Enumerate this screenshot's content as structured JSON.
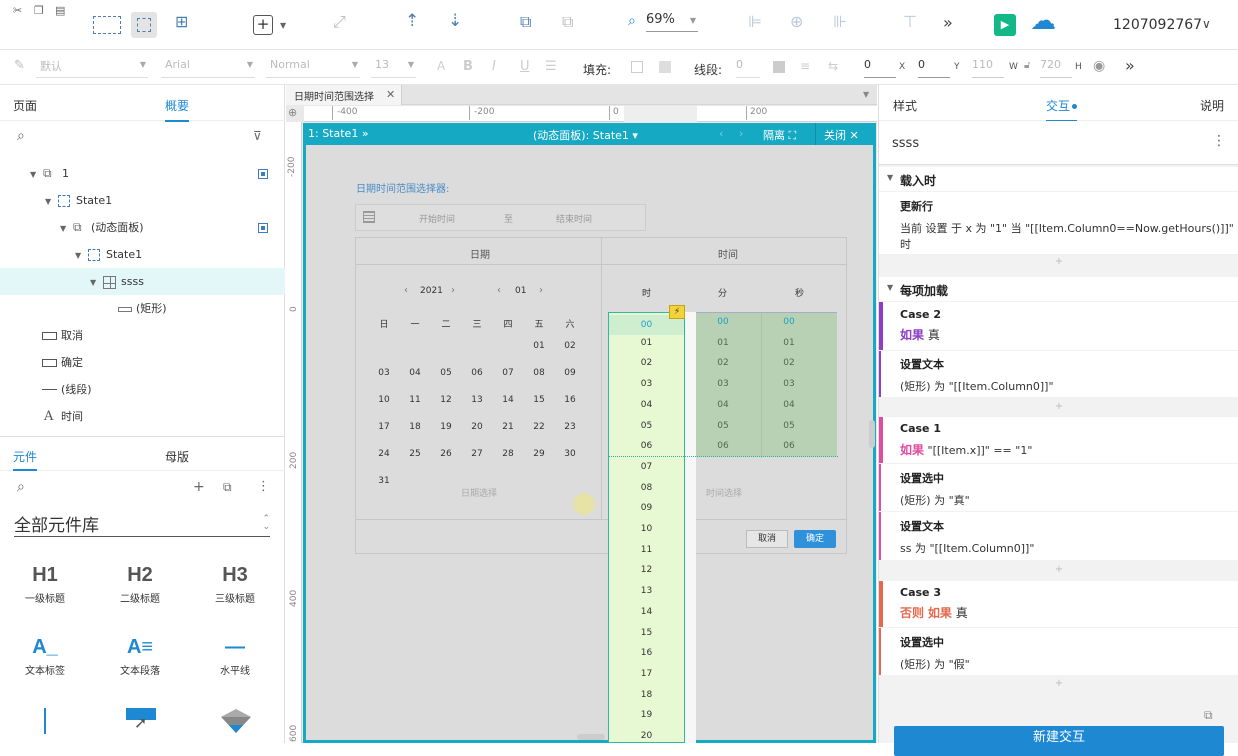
{
  "toolbar": {
    "zoom": "69%",
    "user": "1207092767"
  },
  "format": {
    "style_default": "默认",
    "font": "Arial",
    "weight": "Normal",
    "size": "13",
    "fill_label": "填充:",
    "line_label": "线段:",
    "line_value": "0",
    "x": "0",
    "x_label": "X",
    "y": "0",
    "y_label": "Y",
    "w": "110",
    "w_label": "W",
    "h": "720",
    "h_label": "H"
  },
  "left": {
    "tab_pages": "页面",
    "tab_outline": "概要",
    "tree": [
      {
        "label": "1"
      },
      {
        "label": "State1"
      },
      {
        "label": "(动态面板)"
      },
      {
        "label": "State1"
      },
      {
        "label": "ssss"
      },
      {
        "label": "(矩形)"
      },
      {
        "label": "取消"
      },
      {
        "label": "确定"
      },
      {
        "label": "(线段)"
      },
      {
        "label": "时间"
      }
    ],
    "tab_widgets": "元件",
    "tab_masters": "母版",
    "library": "全部元件库",
    "widgets": [
      {
        "icon": "H1",
        "label": "一级标题"
      },
      {
        "icon": "H2",
        "label": "二级标题"
      },
      {
        "icon": "H3",
        "label": "三级标题"
      },
      {
        "icon": "A_",
        "label": "文本标签"
      },
      {
        "icon": "A≡",
        "label": "文本段落"
      },
      {
        "icon": "—",
        "label": "水平线"
      }
    ]
  },
  "canvas": {
    "doc_tab": "日期时间范围选择",
    "ruler_h": [
      "-400",
      "-200",
      "0",
      "200"
    ],
    "ruler_v": [
      "-200",
      "0",
      "200",
      "400",
      "600"
    ],
    "editor_state": "1: State1",
    "editor_panel": "(动态面板): State1",
    "isolate": "隔离",
    "close": "关闭",
    "widget": {
      "title": "日期时间范围选择器:",
      "start": "开始时间",
      "to": "至",
      "end": "结束时间",
      "date_header": "日期",
      "time_header": "时间",
      "year": "2021",
      "month": "01",
      "weekdays": [
        "日",
        "一",
        "二",
        "三",
        "四",
        "五",
        "六"
      ],
      "days": [
        "01",
        "02",
        "03",
        "04",
        "05",
        "06",
        "07",
        "08",
        "09",
        "10",
        "11",
        "12",
        "13",
        "14",
        "15",
        "16",
        "17",
        "18",
        "19",
        "20",
        "21",
        "22",
        "23",
        "24",
        "25",
        "26",
        "27",
        "28",
        "29",
        "30",
        "31"
      ],
      "date_hint": "日期选择",
      "time_hint": "时间选择",
      "col_hour": "时",
      "col_min": "分",
      "col_sec": "秒",
      "hours": [
        "00",
        "01",
        "02",
        "03",
        "04",
        "05",
        "06",
        "07",
        "08",
        "09",
        "10",
        "11",
        "12",
        "13",
        "14",
        "15",
        "16",
        "17",
        "18",
        "19",
        "20"
      ],
      "mins": [
        "00",
        "01",
        "02",
        "03",
        "04",
        "05",
        "06"
      ],
      "cancel": "取消",
      "ok": "确定"
    }
  },
  "right": {
    "tab_style": "样式",
    "tab_interact": "交互",
    "tab_notes": "说明",
    "element_name": "ssss",
    "section1": "载入时",
    "s1_action": "更新行",
    "s1_desc1": "当前 设置 于 x 为 \"1\" 当 \"[[Item.Column0==Now.getHours()]]\"",
    "s1_desc2": "时",
    "section2": "每项加载",
    "case2": "Case 2",
    "case2_if": "如果",
    "case2_cond": "真",
    "case2_action": "设置文本",
    "case2_desc": "(矩形) 为 \"[[Item.Column0]]\"",
    "case1": "Case 1",
    "case1_if": "如果",
    "case1_cond": "\"[[Item.x]]\" == \"1\"",
    "case1_action1": "设置选中",
    "case1_desc1": "(矩形) 为 \"真\"",
    "case1_action2": "设置文本",
    "case1_desc2": "ss 为 \"[[Item.Column0]]\"",
    "case3": "Case 3",
    "case3_else": "否则",
    "case3_if": "如果",
    "case3_cond": "真",
    "case3_action": "设置选中",
    "case3_desc": "(矩形) 为 \"假\"",
    "new_button": "新建交互"
  }
}
